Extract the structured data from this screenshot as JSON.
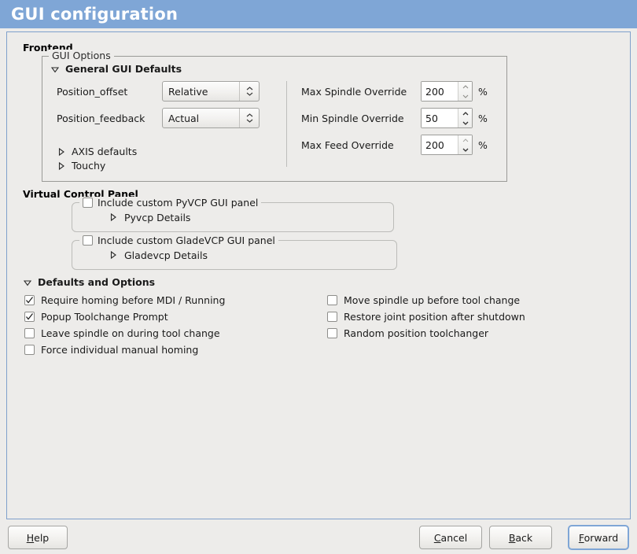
{
  "window": {
    "title": "GUI configuration"
  },
  "frontend": {
    "heading": "Frontend",
    "group_title": "GUI Options",
    "general_defaults_label": "General GUI Defaults",
    "left_fields": [
      {
        "label": "Position_offset",
        "value": "Relative"
      },
      {
        "label": "Position_feedback",
        "value": "Actual"
      }
    ],
    "right_fields": [
      {
        "label": "Max Spindle Override",
        "value": "200",
        "unit": "%"
      },
      {
        "label": "Min Spindle Override",
        "value": "50",
        "unit": "%"
      },
      {
        "label": "Max Feed Override",
        "value": "200",
        "unit": "%"
      }
    ],
    "sub_expanders": [
      {
        "label": "AXIS defaults"
      },
      {
        "label": "Touchy"
      }
    ]
  },
  "virtual_control_panel": {
    "heading": "Virtual Control Panel",
    "pyvcp": {
      "checkbox_label": "Include custom PyVCP GUI panel",
      "checked": false,
      "details_label": "Pyvcp Details"
    },
    "gladevcp": {
      "checkbox_label": "Include custom GladeVCP GUI panel",
      "checked": false,
      "details_label": "Gladevcp Details"
    }
  },
  "defaults_and_options": {
    "heading": "Defaults and Options",
    "left_options": [
      {
        "label": "Require homing before MDI / Running",
        "checked": true
      },
      {
        "label": "Popup Toolchange Prompt",
        "checked": true
      },
      {
        "label": "Leave spindle on during tool change",
        "checked": false
      },
      {
        "label": "Force individual manual homing",
        "checked": false
      }
    ],
    "right_options": [
      {
        "label": "Move spindle up before tool change",
        "checked": false
      },
      {
        "label": "Restore joint position after shutdown",
        "checked": false
      },
      {
        "label": "Random position toolchanger",
        "checked": false
      }
    ]
  },
  "buttons": {
    "help": {
      "before": "",
      "mnemonic": "H",
      "after": "elp"
    },
    "cancel": {
      "before": "",
      "mnemonic": "C",
      "after": "ancel"
    },
    "back": {
      "before": "",
      "mnemonic": "B",
      "after": "ack"
    },
    "forward": {
      "before": "",
      "mnemonic": "F",
      "after": "orward"
    }
  },
  "colors": {
    "titlebar": "#7fa6d6",
    "panel_background": "#edecea",
    "panel_border": "#7fa0cc",
    "focus_border": "#7fa6d6"
  }
}
